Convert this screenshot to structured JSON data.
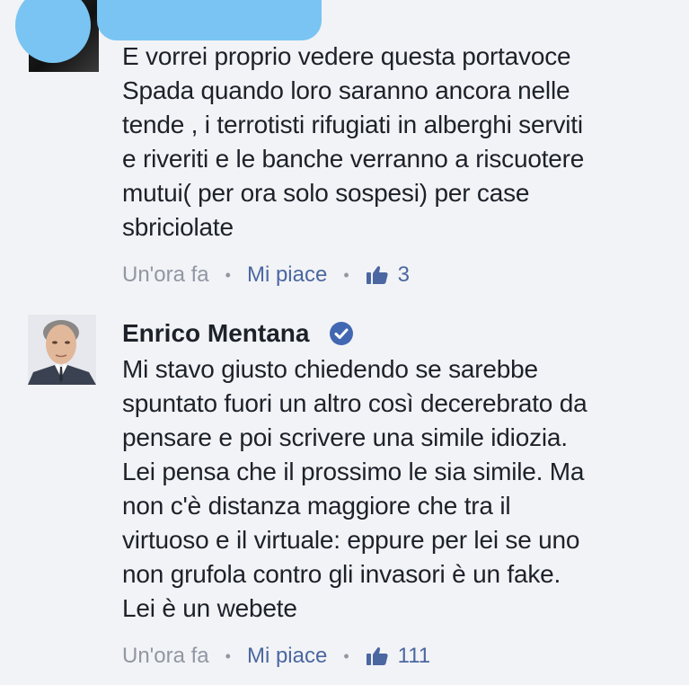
{
  "comments": [
    {
      "author_hidden": true,
      "text": "E vorrei proprio vedere questa portavoce\nSpada quando loro saranno ancora nelle\ntende , i terrotisti rifugiati in alberghi serviti\ne riveriti e le banche verranno a riscuotere\nmutui( per ora solo sospesi) per case\nsbriciolate",
      "time": "Un'ora fa",
      "like_label": "Mi piace",
      "like_count": "3",
      "icons": {
        "like": "thumbs-up-icon"
      }
    },
    {
      "author": "Enrico Mentana",
      "verified": true,
      "text": "Mi stavo giusto chiedendo se sarebbe\nspuntato fuori un altro così decerebrato da\npensare e poi scrivere una simile idiozia.\nLei pensa che il prossimo le sia simile. Ma\nnon c'è distanza maggiore che tra il\nvirtuoso e il virtuale: eppure per lei se uno\nnon grufola contro gli invasori è un fake.\nLei è un webete",
      "time": "Un'ora fa",
      "like_label": "Mi piace",
      "like_count": "111",
      "icons": {
        "verified": "verified-badge-icon",
        "like": "thumbs-up-icon"
      }
    }
  ],
  "separator": "•",
  "colors": {
    "background": "#f2f3f6",
    "text": "#1d2129",
    "meta": "#9197a3",
    "link": "#4b67a1",
    "verified": "#4267b2",
    "redaction": "#79c4f2"
  }
}
